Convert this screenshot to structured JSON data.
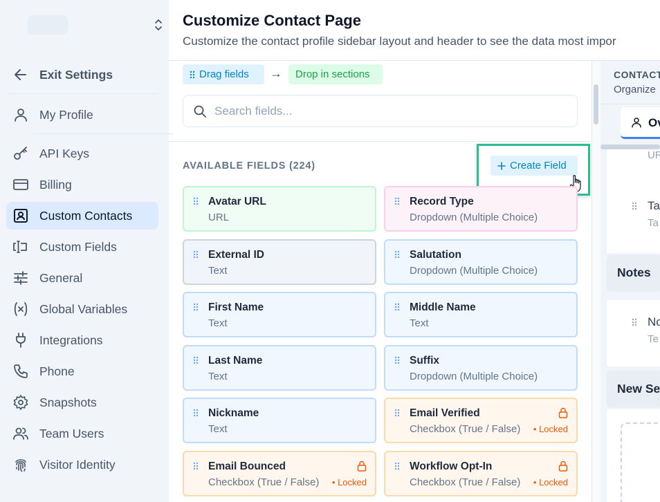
{
  "sidebar": {
    "exit_label": "Exit Settings",
    "items": [
      {
        "label": "My Profile",
        "icon": "user-icon"
      },
      {
        "label": "API Keys",
        "icon": "key-icon"
      },
      {
        "label": "Billing",
        "icon": "credit-card-icon"
      },
      {
        "label": "Custom Contacts",
        "icon": "contact-card-icon",
        "active": true
      },
      {
        "label": "Custom Fields",
        "icon": "text-cursor-icon"
      },
      {
        "label": "General",
        "icon": "sliders-icon"
      },
      {
        "label": "Global Variables",
        "icon": "variable-icon"
      },
      {
        "label": "Integrations",
        "icon": "plug-icon"
      },
      {
        "label": "Phone",
        "icon": "phone-icon"
      },
      {
        "label": "Snapshots",
        "icon": "gear-icon"
      },
      {
        "label": "Team Users",
        "icon": "users-icon"
      },
      {
        "label": "Visitor Identity",
        "icon": "fingerprint-icon"
      }
    ]
  },
  "header": {
    "title": "Customize Contact Page",
    "subtitle": "Customize the contact profile sidebar layout and header to see the data most impor"
  },
  "instructions": {
    "drag_label": "Drag fields",
    "drop_label": "Drop in sections",
    "arrow": "→"
  },
  "search": {
    "placeholder": "Search fields..."
  },
  "fields": {
    "title": "AVAILABLE FIELDS (224)",
    "create_label": "Create Field",
    "locked_label": "Locked",
    "items": [
      {
        "name": "Avatar URL",
        "type": "URL",
        "color": "green"
      },
      {
        "name": "Record Type",
        "type": "Dropdown (Multiple Choice)",
        "color": "pink"
      },
      {
        "name": "External ID",
        "type": "Text",
        "color": "gray"
      },
      {
        "name": "Salutation",
        "type": "Dropdown (Multiple Choice)",
        "color": "blue"
      },
      {
        "name": "First Name",
        "type": "Text",
        "color": "blue"
      },
      {
        "name": "Middle Name",
        "type": "Text",
        "color": "blue"
      },
      {
        "name": "Last Name",
        "type": "Text",
        "color": "blue"
      },
      {
        "name": "Suffix",
        "type": "Dropdown (Multiple Choice)",
        "color": "blue"
      },
      {
        "name": "Nickname",
        "type": "Text",
        "color": "blue"
      },
      {
        "name": "Email Verified",
        "type": "Checkbox (True / False)",
        "color": "amber",
        "locked": true
      },
      {
        "name": "Email Bounced",
        "type": "Checkbox (True / False)",
        "color": "amber",
        "locked": true
      },
      {
        "name": "Workflow Opt-In",
        "type": "Checkbox (True / False)",
        "color": "amber",
        "locked": true
      }
    ]
  },
  "right_panel": {
    "heading": "CONTACT",
    "subheading": "Organize",
    "tab_label": "Ov",
    "row1_type": "UR",
    "row2_name": "Ta",
    "row2_type": "Ta",
    "notes_label": "Notes",
    "row3_name": "No",
    "row3_type": "Te",
    "new_section_label": "New Se"
  }
}
